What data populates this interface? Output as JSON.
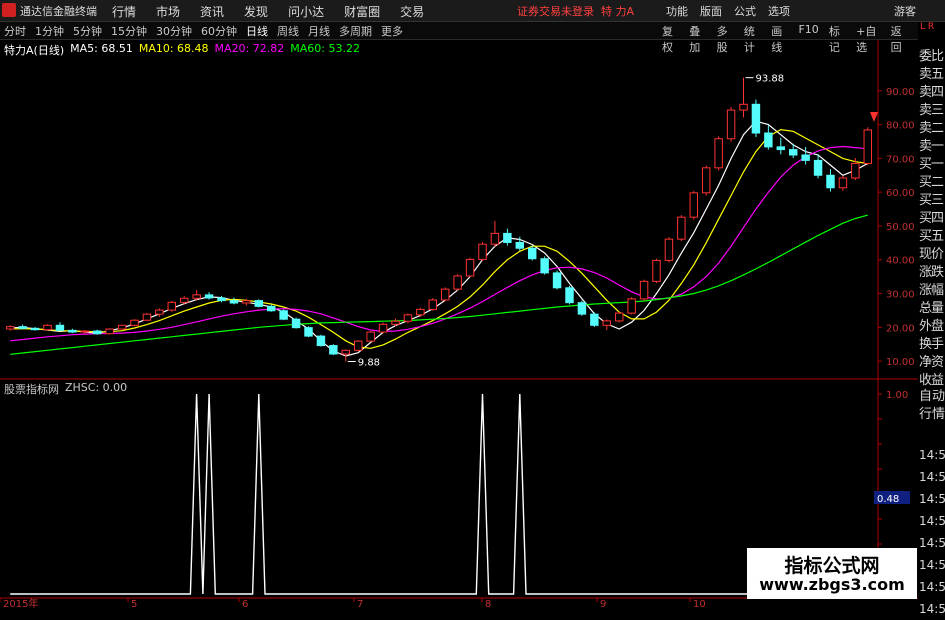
{
  "menubar": {
    "app_title": "通达信金融终端",
    "menus": [
      "行情",
      "市场",
      "资讯",
      "发现",
      "问小达",
      "财富圈",
      "交易"
    ],
    "notice": "证券交易未登录",
    "stock_label": "特 力A",
    "right_items": [
      "功能",
      "版面",
      "公式",
      "选项"
    ],
    "guest": "游客"
  },
  "toolbar": {
    "periods": [
      "分时",
      "1分钟",
      "5分钟",
      "15分钟",
      "30分钟",
      "60分钟",
      "日线",
      "周线",
      "月线",
      "多周期",
      "更多"
    ],
    "active_period": "日线",
    "tools": [
      "复权",
      "叠加",
      "多股",
      "统计",
      "画线",
      "F10",
      "标记",
      "+自选",
      "返回"
    ]
  },
  "ma_line": {
    "title": "特力A(日线)",
    "items": [
      {
        "label": "MA5: 68.51",
        "color": "#ffffff"
      },
      {
        "label": "MA10: 68.48",
        "color": "#ffff00"
      },
      {
        "label": "MA20: 72.82",
        "color": "#ff00ff"
      },
      {
        "label": "MA60: 53.22",
        "color": "#00ff00"
      }
    ]
  },
  "indicator_line": {
    "title": "股票指标网",
    "value": "ZHSC: 0.00"
  },
  "right_panel": {
    "lr": "L R",
    "items": [
      "委比",
      "卖五",
      "卖四",
      "卖三",
      "卖二",
      "卖一",
      "买一",
      "买二",
      "买三",
      "买四",
      "买五",
      "现价",
      "涨跌",
      "涨幅",
      "总量",
      "外盘",
      "换手",
      "净资",
      "收益"
    ],
    "items2": [
      "自动",
      "行情"
    ],
    "times": [
      "14:5",
      "14:5",
      "14:5",
      "14:5",
      "14:5",
      "14:5",
      "14:5",
      "14:5"
    ]
  },
  "watermark": {
    "line1": "指标公式网",
    "line2": "www.zbgs3.com"
  },
  "colors": {
    "up": "#ff3232",
    "down": "#54fcfc",
    "ma5": "#ffffff",
    "ma10": "#ffff00",
    "ma20": "#ff00ff",
    "ma60": "#00ff00",
    "axis": "#b00000"
  },
  "chart_data": [
    {
      "type": "candlestick",
      "title": "特力A(日线)",
      "ylim": [
        5,
        100
      ],
      "yticks": [
        10.0,
        20.0,
        30.0,
        40.0,
        50.0,
        60.0,
        70.0,
        80.0,
        90.0
      ],
      "x_labels": [
        "2015年",
        "5",
        "6",
        "7",
        "8",
        "9",
        "10"
      ],
      "annotations": [
        {
          "text": "93.88",
          "kind": "high",
          "value": 93.88
        },
        {
          "text": "9.88",
          "kind": "low",
          "value": 9.88
        }
      ],
      "series": [
        {
          "name": "MA5",
          "color": "#ffffff",
          "last": 68.51,
          "values": [
            19.8,
            20.0,
            19.6,
            19.2,
            18.8,
            19.0,
            18.6,
            18.2,
            19.0,
            19.8,
            21.0,
            22.5,
            24.0,
            25.6,
            27.0,
            28.2,
            29.0,
            28.8,
            28.0,
            27.4,
            26.8,
            26.0,
            24.5,
            22.0,
            19.5,
            16.0,
            13.0,
            11.5,
            12.5,
            15.5,
            18.5,
            20.5,
            22.0,
            23.5,
            25.5,
            28.0,
            31.0,
            35.0,
            40.0,
            44.0,
            46.5,
            46.0,
            44.5,
            42.0,
            38.0,
            33.0,
            28.5,
            24.0,
            21.0,
            19.5,
            21.5,
            25.0,
            30.0,
            35.5,
            42.0,
            48.0,
            55.0,
            62.0,
            70.0,
            77.0,
            81.0,
            80.0,
            77.0,
            74.0,
            72.0,
            71.0,
            68.0,
            65.0,
            66.5,
            68.51
          ]
        },
        {
          "name": "MA10",
          "color": "#ffff00",
          "last": 68.48,
          "values": [
            19.5,
            19.6,
            19.5,
            19.3,
            19.0,
            18.9,
            18.8,
            18.6,
            18.7,
            19.0,
            19.8,
            20.8,
            22.0,
            23.4,
            24.8,
            26.0,
            27.2,
            28.0,
            28.3,
            28.0,
            27.5,
            26.9,
            26.0,
            24.8,
            23.0,
            20.8,
            18.5,
            16.0,
            14.2,
            13.8,
            14.8,
            16.5,
            18.5,
            20.2,
            22.0,
            24.0,
            26.2,
            29.0,
            32.5,
            36.5,
            40.0,
            42.5,
            44.0,
            44.0,
            42.5,
            39.5,
            36.0,
            32.0,
            28.0,
            24.5,
            22.5,
            22.5,
            24.5,
            28.0,
            33.0,
            38.5,
            45.0,
            52.0,
            59.0,
            66.0,
            72.0,
            76.5,
            78.5,
            78.0,
            76.0,
            74.0,
            72.0,
            70.0,
            69.0,
            68.48
          ]
        },
        {
          "name": "MA20",
          "color": "#ff00ff",
          "last": 72.82,
          "values": [
            16.0,
            16.4,
            16.8,
            17.2,
            17.5,
            17.8,
            18.0,
            18.1,
            18.2,
            18.3,
            18.5,
            18.9,
            19.4,
            20.0,
            20.8,
            21.6,
            22.5,
            23.3,
            24.0,
            24.6,
            25.1,
            25.4,
            25.5,
            25.3,
            24.8,
            24.0,
            22.8,
            21.5,
            20.2,
            19.2,
            18.8,
            18.9,
            19.4,
            20.2,
            21.2,
            22.5,
            24.0,
            25.7,
            27.6,
            29.7,
            31.8,
            33.8,
            35.5,
            36.8,
            37.6,
            37.8,
            37.3,
            36.2,
            34.6,
            32.5,
            30.5,
            29.0,
            28.4,
            28.6,
            29.8,
            32.0,
            35.0,
            39.0,
            44.0,
            49.5,
            55.0,
            60.0,
            64.5,
            68.0,
            70.5,
            72.2,
            73.2,
            73.5,
            73.2,
            72.82
          ]
        },
        {
          "name": "MA60",
          "color": "#00ff00",
          "last": 53.22,
          "values": [
            12.0,
            12.4,
            12.8,
            13.2,
            13.6,
            14.0,
            14.4,
            14.8,
            15.2,
            15.6,
            16.0,
            16.4,
            16.8,
            17.2,
            17.6,
            18.0,
            18.4,
            18.8,
            19.2,
            19.6,
            20.0,
            20.3,
            20.6,
            20.9,
            21.1,
            21.3,
            21.4,
            21.5,
            21.6,
            21.7,
            21.8,
            21.9,
            22.0,
            22.2,
            22.4,
            22.6,
            22.9,
            23.2,
            23.6,
            24.0,
            24.4,
            24.8,
            25.2,
            25.6,
            26.0,
            26.3,
            26.6,
            26.9,
            27.1,
            27.3,
            27.5,
            27.8,
            28.2,
            28.7,
            29.3,
            30.0,
            31.0,
            32.3,
            33.8,
            35.5,
            37.3,
            39.2,
            41.2,
            43.2,
            45.2,
            47.2,
            49.0,
            50.8,
            52.2,
            53.22
          ]
        }
      ],
      "candles": [
        {
          "o": 19.5,
          "h": 20.6,
          "l": 19.0,
          "c": 20.2
        },
        {
          "o": 20.2,
          "h": 20.8,
          "l": 19.4,
          "c": 19.7
        },
        {
          "o": 19.7,
          "h": 20.1,
          "l": 19.0,
          "c": 19.3
        },
        {
          "o": 19.3,
          "h": 20.9,
          "l": 19.1,
          "c": 20.6
        },
        {
          "o": 20.6,
          "h": 21.5,
          "l": 18.9,
          "c": 19.1
        },
        {
          "o": 19.1,
          "h": 19.6,
          "l": 18.3,
          "c": 18.6
        },
        {
          "o": 18.6,
          "h": 19.2,
          "l": 18.0,
          "c": 18.9
        },
        {
          "o": 18.9,
          "h": 19.3,
          "l": 17.8,
          "c": 18.1
        },
        {
          "o": 18.1,
          "h": 19.7,
          "l": 17.9,
          "c": 19.5
        },
        {
          "o": 19.5,
          "h": 20.8,
          "l": 19.3,
          "c": 20.6
        },
        {
          "o": 20.6,
          "h": 22.4,
          "l": 20.3,
          "c": 22.1
        },
        {
          "o": 22.1,
          "h": 24.2,
          "l": 21.8,
          "c": 23.9
        },
        {
          "o": 23.9,
          "h": 25.6,
          "l": 23.1,
          "c": 25.1
        },
        {
          "o": 25.1,
          "h": 27.8,
          "l": 24.6,
          "c": 27.4
        },
        {
          "o": 27.4,
          "h": 29.2,
          "l": 26.7,
          "c": 28.6
        },
        {
          "o": 28.6,
          "h": 31.0,
          "l": 27.9,
          "c": 29.6
        },
        {
          "o": 29.6,
          "h": 30.4,
          "l": 28.2,
          "c": 28.7
        },
        {
          "o": 28.7,
          "h": 29.3,
          "l": 27.4,
          "c": 27.9
        },
        {
          "o": 27.9,
          "h": 28.8,
          "l": 26.8,
          "c": 27.2
        },
        {
          "o": 27.2,
          "h": 28.4,
          "l": 26.4,
          "c": 27.9
        },
        {
          "o": 27.9,
          "h": 28.3,
          "l": 25.9,
          "c": 26.2
        },
        {
          "o": 26.2,
          "h": 26.7,
          "l": 24.6,
          "c": 24.9
        },
        {
          "o": 24.9,
          "h": 25.3,
          "l": 22.1,
          "c": 22.4
        },
        {
          "o": 22.4,
          "h": 22.9,
          "l": 19.6,
          "c": 19.9
        },
        {
          "o": 19.9,
          "h": 20.3,
          "l": 17.1,
          "c": 17.4
        },
        {
          "o": 17.4,
          "h": 17.8,
          "l": 14.3,
          "c": 14.6
        },
        {
          "o": 14.6,
          "h": 15.0,
          "l": 11.8,
          "c": 12.1
        },
        {
          "o": 12.1,
          "h": 13.5,
          "l": 9.88,
          "c": 13.2
        },
        {
          "o": 13.2,
          "h": 16.2,
          "l": 12.9,
          "c": 15.9
        },
        {
          "o": 15.9,
          "h": 18.9,
          "l": 15.6,
          "c": 18.6
        },
        {
          "o": 18.6,
          "h": 21.4,
          "l": 18.2,
          "c": 20.9
        },
        {
          "o": 20.9,
          "h": 22.6,
          "l": 20.3,
          "c": 21.8
        },
        {
          "o": 21.8,
          "h": 24.1,
          "l": 21.2,
          "c": 23.7
        },
        {
          "o": 23.7,
          "h": 25.8,
          "l": 23.1,
          "c": 25.3
        },
        {
          "o": 25.3,
          "h": 28.6,
          "l": 24.9,
          "c": 28.1
        },
        {
          "o": 28.1,
          "h": 31.8,
          "l": 27.7,
          "c": 31.3
        },
        {
          "o": 31.3,
          "h": 35.7,
          "l": 30.9,
          "c": 35.2
        },
        {
          "o": 35.2,
          "h": 40.6,
          "l": 34.8,
          "c": 40.1
        },
        {
          "o": 40.1,
          "h": 45.2,
          "l": 39.6,
          "c": 44.6
        },
        {
          "o": 44.6,
          "h": 51.5,
          "l": 43.9,
          "c": 47.8
        },
        {
          "o": 47.8,
          "h": 49.2,
          "l": 44.2,
          "c": 45.1
        },
        {
          "o": 45.1,
          "h": 46.8,
          "l": 42.7,
          "c": 43.4
        },
        {
          "o": 43.4,
          "h": 44.1,
          "l": 39.8,
          "c": 40.3
        },
        {
          "o": 40.3,
          "h": 41.0,
          "l": 35.6,
          "c": 36.1
        },
        {
          "o": 36.1,
          "h": 36.8,
          "l": 31.2,
          "c": 31.7
        },
        {
          "o": 31.7,
          "h": 32.3,
          "l": 26.8,
          "c": 27.3
        },
        {
          "o": 27.3,
          "h": 27.9,
          "l": 23.4,
          "c": 23.9
        },
        {
          "o": 23.9,
          "h": 24.4,
          "l": 20.1,
          "c": 20.6
        },
        {
          "o": 20.6,
          "h": 22.3,
          "l": 19.2,
          "c": 21.9
        },
        {
          "o": 21.9,
          "h": 24.7,
          "l": 21.4,
          "c": 24.2
        },
        {
          "o": 24.2,
          "h": 28.9,
          "l": 23.8,
          "c": 28.4
        },
        {
          "o": 28.4,
          "h": 34.1,
          "l": 27.9,
          "c": 33.6
        },
        {
          "o": 33.6,
          "h": 40.3,
          "l": 33.1,
          "c": 39.8
        },
        {
          "o": 39.8,
          "h": 46.7,
          "l": 39.2,
          "c": 46.1
        },
        {
          "o": 46.1,
          "h": 53.2,
          "l": 45.5,
          "c": 52.6
        },
        {
          "o": 52.6,
          "h": 60.4,
          "l": 51.9,
          "c": 59.8
        },
        {
          "o": 59.8,
          "h": 67.9,
          "l": 59.0,
          "c": 67.2
        },
        {
          "o": 67.2,
          "h": 76.5,
          "l": 66.4,
          "c": 75.8
        },
        {
          "o": 75.8,
          "h": 85.2,
          "l": 74.9,
          "c": 84.3
        },
        {
          "o": 84.3,
          "h": 93.88,
          "l": 82.1,
          "c": 86.0
        },
        {
          "o": 86.0,
          "h": 87.4,
          "l": 76.3,
          "c": 77.5
        },
        {
          "o": 77.5,
          "h": 79.8,
          "l": 72.6,
          "c": 73.4
        },
        {
          "o": 73.4,
          "h": 76.1,
          "l": 71.2,
          "c": 72.6
        },
        {
          "o": 72.6,
          "h": 74.3,
          "l": 70.1,
          "c": 71.0
        },
        {
          "o": 71.0,
          "h": 73.4,
          "l": 68.2,
          "c": 69.4
        },
        {
          "o": 69.4,
          "h": 71.2,
          "l": 64.1,
          "c": 65.0
        },
        {
          "o": 65.0,
          "h": 66.8,
          "l": 60.2,
          "c": 61.3
        },
        {
          "o": 61.3,
          "h": 64.9,
          "l": 60.4,
          "c": 64.2
        },
        {
          "o": 64.2,
          "h": 70.1,
          "l": 63.6,
          "c": 68.5
        },
        {
          "o": 68.5,
          "h": 79.2,
          "l": 68.0,
          "c": 78.4
        }
      ]
    },
    {
      "type": "line",
      "title": "股票指标网",
      "series": [
        {
          "name": "ZHSC",
          "color": "#ffffff",
          "last": 0.0
        }
      ],
      "ylim": [
        0,
        1.0
      ],
      "yticks": [
        1.0
      ],
      "marker_value": 0.48,
      "pulses": [
        {
          "start": 15,
          "peak": 1.0
        },
        {
          "start": 16,
          "peak": 1.0
        },
        {
          "start": 20,
          "peak": 1.0
        },
        {
          "start": 38,
          "peak": 1.0
        },
        {
          "start": 41,
          "peak": 1.0
        }
      ],
      "n_points": 70
    }
  ]
}
